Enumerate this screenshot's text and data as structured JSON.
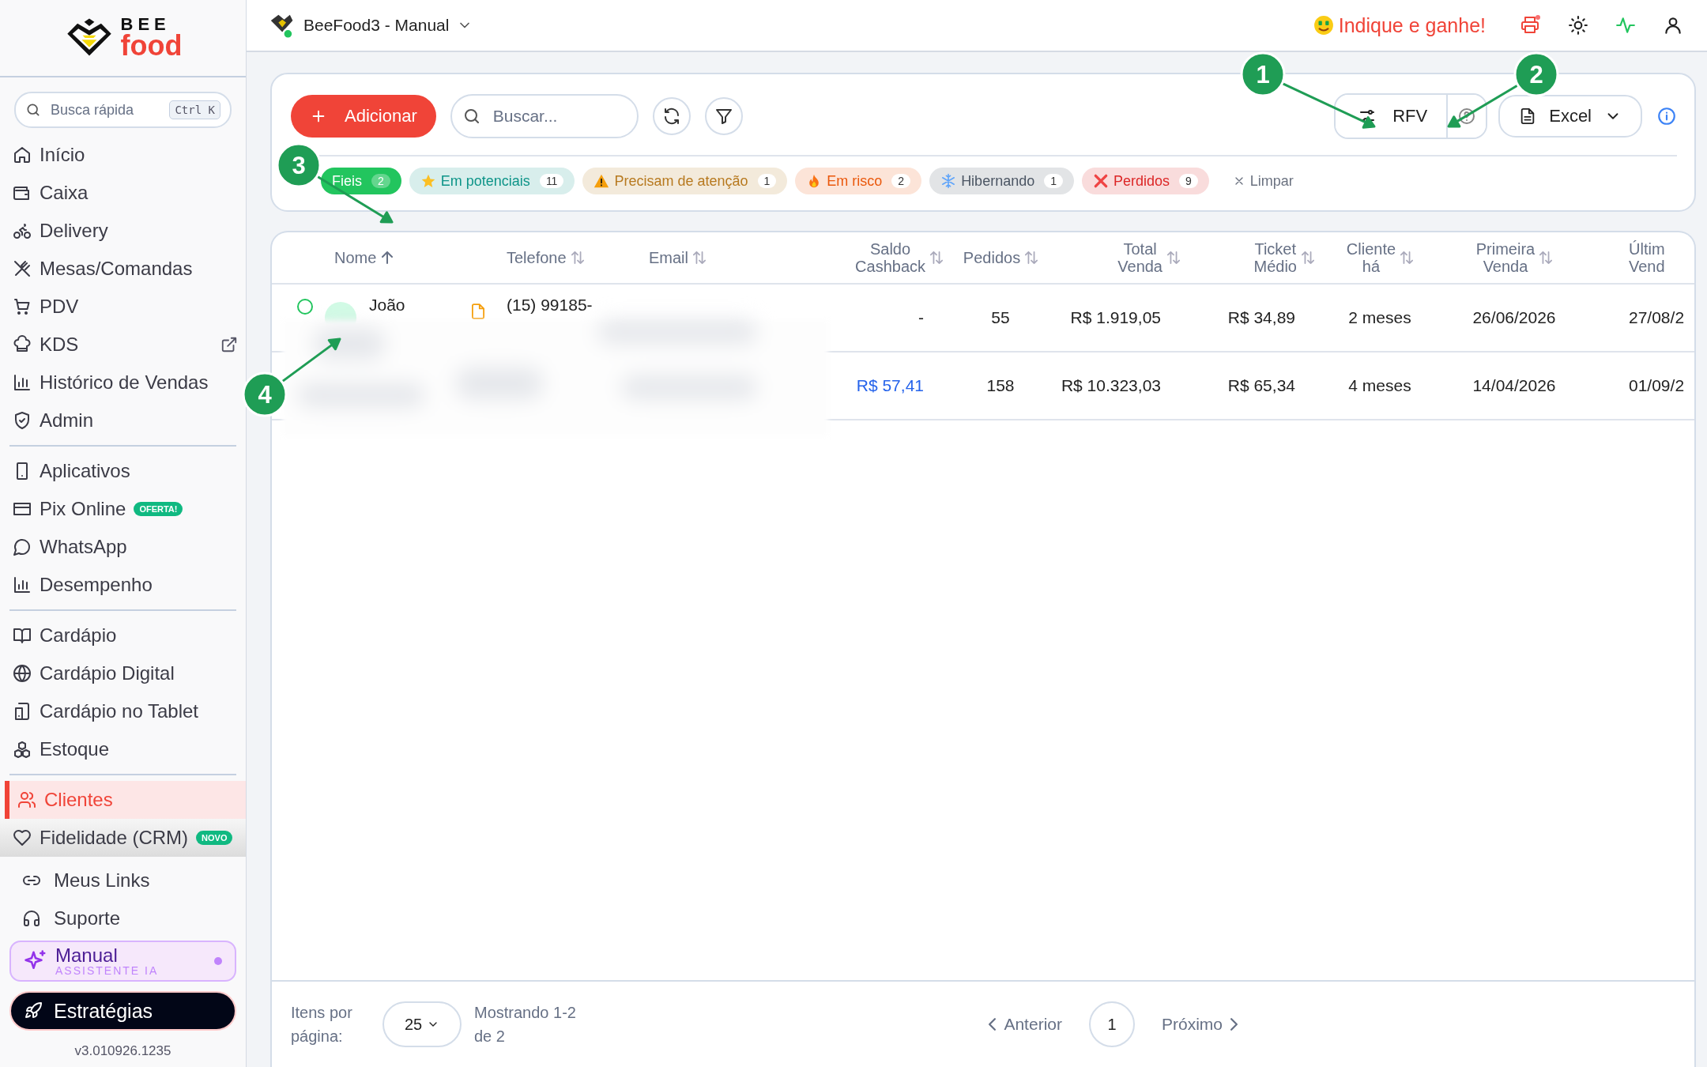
{
  "brand": {
    "line1": "BEE",
    "line2": "food"
  },
  "quick_search": {
    "placeholder": "Busca rápida",
    "shortcut": "Ctrl K"
  },
  "sidebar": {
    "groups": [
      [
        {
          "label": "Início",
          "kind": "home",
          "selected": false
        },
        {
          "label": "Caixa",
          "kind": "wallet",
          "selected": false
        },
        {
          "label": "Delivery",
          "kind": "bike",
          "selected": false
        },
        {
          "label": "Mesas/Comandas",
          "kind": "utensils",
          "selected": false
        },
        {
          "label": "PDV",
          "kind": "cart",
          "selected": false
        },
        {
          "label": "KDS",
          "kind": "chef",
          "external": true,
          "selected": false
        },
        {
          "label": "Histórico de Vendas",
          "kind": "chart",
          "selected": false
        },
        {
          "label": "Admin",
          "kind": "shield",
          "selected": false
        }
      ],
      [
        {
          "label": "Aplicativos",
          "kind": "phone",
          "selected": false
        },
        {
          "label": "Pix Online",
          "kind": "card",
          "badge": "OFERTA!",
          "selected": false
        },
        {
          "label": "WhatsApp",
          "kind": "chat",
          "selected": false
        },
        {
          "label": "Desempenho",
          "kind": "chart",
          "selected": false
        }
      ],
      [
        {
          "label": "Cardápio",
          "kind": "book",
          "selected": false
        },
        {
          "label": "Cardápio Digital",
          "kind": "globe",
          "selected": false
        },
        {
          "label": "Cardápio no Tablet",
          "kind": "tablet",
          "selected": false
        },
        {
          "label": "Estoque",
          "kind": "boxes",
          "selected": false
        }
      ],
      [
        {
          "label": "Clientes",
          "kind": "users",
          "selected": true
        },
        {
          "label": "Fidelidade (CRM)",
          "kind": "heart",
          "badge": "NOVO",
          "selected": false
        }
      ]
    ]
  },
  "sidebar_links": [
    {
      "label": "Meus Links",
      "kind": "link"
    },
    {
      "label": "Suporte",
      "kind": "headphones"
    }
  ],
  "assistant": {
    "title": "Manual",
    "subtitle": "ASSISTENTE IA"
  },
  "strategy_button": "Estratégias",
  "version": "v3.010926.1235",
  "topbar": {
    "store": "BeeFood3 - Manual",
    "referral": "Indique e ganhe!"
  },
  "toolbar": {
    "add_button": "Adicionar",
    "search": {
      "placeholder": "Buscar..."
    },
    "rfv_button": "RFV",
    "excel_button": "Excel"
  },
  "segments": [
    {
      "label": "Fieis",
      "kind": "plain",
      "count": "2",
      "color": "#22c55e",
      "selected": true
    },
    {
      "label": "Em potenciais",
      "kind": "star",
      "count": "11",
      "color": "#0d9488",
      "selected": false
    },
    {
      "label": "Precisam de atenção",
      "kind": "warning",
      "count": "1",
      "color": "#b7791f",
      "selected": false
    },
    {
      "label": "Em risco",
      "kind": "flame",
      "count": "2",
      "color": "#ea580c",
      "selected": false
    },
    {
      "label": "Hibernando",
      "kind": "snow",
      "count": "1",
      "color": "#4b5563",
      "selected": false
    },
    {
      "label": "Perdidos",
      "kind": "cross",
      "count": "9",
      "color": "#dc2626",
      "selected": false
    }
  ],
  "clear_filters": "Limpar",
  "table": {
    "columns": [
      {
        "lines": [
          "Nome"
        ],
        "sorted": true
      },
      {
        "lines": [
          "Telefone"
        ],
        "sorted": false
      },
      {
        "lines": [
          "Email"
        ],
        "sorted": false
      },
      {
        "lines": [
          "Saldo",
          "Cashback"
        ],
        "sorted": false
      },
      {
        "lines": [
          "Pedidos"
        ],
        "sorted": false
      },
      {
        "lines": [
          "Total",
          "Venda"
        ],
        "sorted": false
      },
      {
        "lines": [
          "Ticket",
          "Médio"
        ],
        "sorted": false
      },
      {
        "lines": [
          "Cliente",
          "há"
        ],
        "sorted": false
      },
      {
        "lines": [
          "Primeira",
          "Venda"
        ],
        "sorted": false
      },
      {
        "lines": [
          "Últim",
          "Vend"
        ]
      }
    ],
    "rows": [
      {
        "checked": false,
        "name": "João",
        "phone": "(15) 99185-",
        "cashback": "-",
        "cashback_link": false,
        "orders": "55",
        "total": "R$ 1.919,05",
        "ticket": "R$ 34,89",
        "since": "2 meses",
        "first": "26/06/2026",
        "last": "27/08/2"
      },
      {
        "cashback": "R$ 57,41",
        "cashback_link": true,
        "orders": "158",
        "total": "R$ 10.323,03",
        "ticket": "R$ 65,34",
        "since": "4 meses",
        "first": "14/04/2026",
        "last": "01/09/2"
      }
    ]
  },
  "pagination": {
    "per_page_label": "Itens por página:",
    "per_page": "25",
    "showing": "Mostrando 1-2 de 2",
    "previous": "Anterior",
    "pages": [
      {
        "label": "1",
        "selected": true
      }
    ],
    "next": "Próximo"
  },
  "annotations": [
    {
      "number": "1"
    },
    {
      "number": "2"
    },
    {
      "number": "3"
    },
    {
      "number": "4"
    }
  ]
}
